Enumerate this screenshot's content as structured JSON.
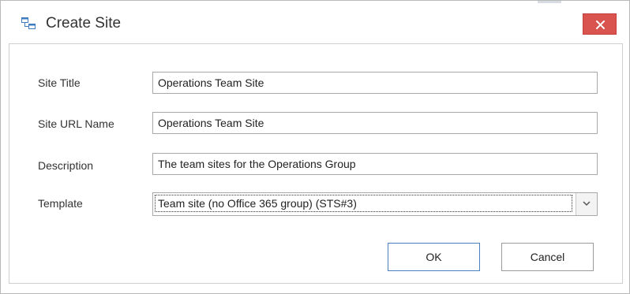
{
  "dialog": {
    "title": "Create Site",
    "close_icon": "close-icon",
    "title_icon": "site-icon"
  },
  "form": {
    "site_title": {
      "label": "Site Title",
      "value": "Operations Team Site"
    },
    "site_url": {
      "label": "Site URL Name",
      "value": "Operations Team Site"
    },
    "description": {
      "label": "Description",
      "value": "The team sites for the Operations Group"
    },
    "template": {
      "label": "Template",
      "value": "Team site (no Office 365 group) (STS#3)"
    }
  },
  "buttons": {
    "ok_label": "OK",
    "cancel_label": "Cancel"
  },
  "colors": {
    "close_button": "#d9534f",
    "ok_border": "#4a7fbf",
    "accent_icon": "#3f7cc0"
  }
}
